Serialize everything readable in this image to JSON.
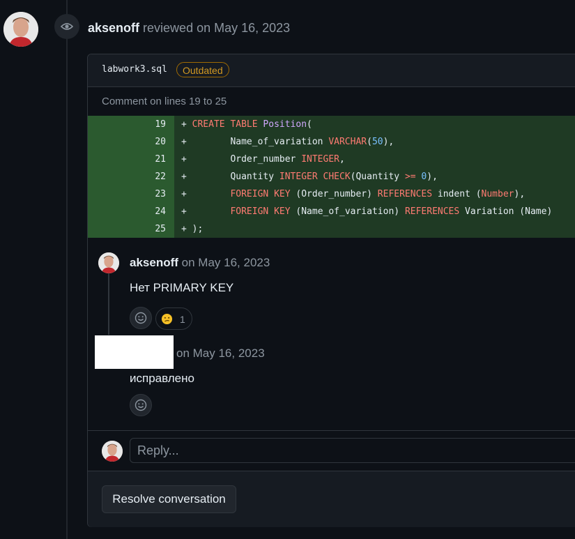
{
  "review": {
    "user": "aksenoff",
    "action": "reviewed on May 16, 2023"
  },
  "file": {
    "name": "labwork3.sql",
    "badge": "Outdated",
    "comment_range": "Comment on lines 19 to 25"
  },
  "diff": {
    "lines": [
      {
        "num": "19"
      },
      {
        "num": "20"
      },
      {
        "num": "21"
      },
      {
        "num": "22"
      },
      {
        "num": "23"
      },
      {
        "num": "24"
      },
      {
        "num": "25"
      }
    ]
  },
  "comments": [
    {
      "user": "aksenoff",
      "date": "on May 16, 2023",
      "body": "Нет PRIMARY KEY",
      "reaction": {
        "emoji": "confused-face-icon",
        "count": "1"
      }
    },
    {
      "user": "",
      "date": "on May 16, 2023",
      "body": "исправлено"
    }
  ],
  "reply": {
    "placeholder": "Reply..."
  },
  "resolve": {
    "label": "Resolve conversation"
  },
  "colors": {
    "added_line_bg": "#1f3a24",
    "added_num_bg": "#2b5a2f",
    "keyword": "#ff7b72",
    "outdated": "#d29922"
  }
}
